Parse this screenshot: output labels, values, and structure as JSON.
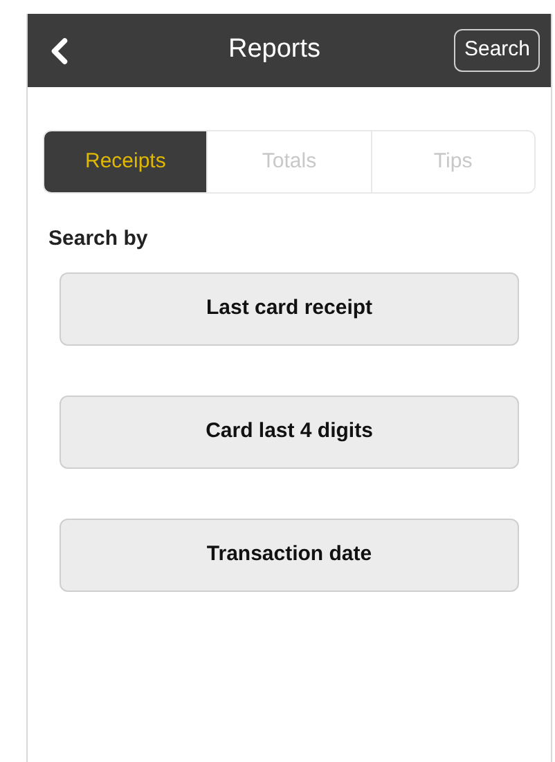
{
  "header": {
    "title": "Reports",
    "action": "Search"
  },
  "tabs": [
    {
      "label": "Receipts",
      "selected": true
    },
    {
      "label": "Totals",
      "selected": false
    },
    {
      "label": "Tips",
      "selected": false
    }
  ],
  "section_label": "Search by",
  "options": [
    "Last card receipt",
    "Card last 4 digits",
    "Transaction date"
  ]
}
